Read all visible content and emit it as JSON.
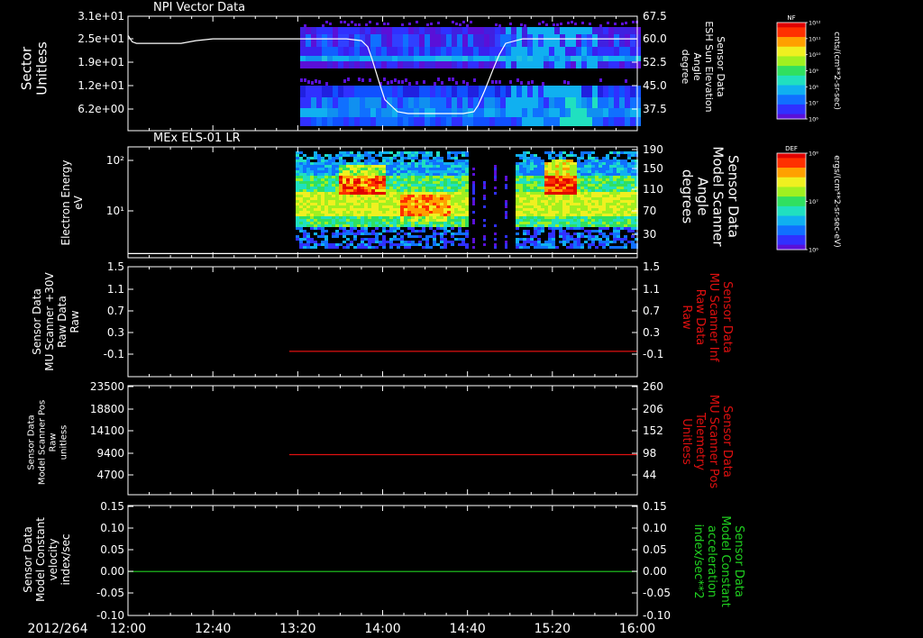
{
  "chart_data": [
    {
      "type": "heatmap",
      "title": "NPI Vector Data",
      "ylabel_left": [
        "Sector",
        "Unitless"
      ],
      "ylabel_right": [
        "Sensor Data",
        "ESH Sun Elevation",
        "Angle",
        "degree"
      ],
      "left_ticks": [
        "3.1e+01",
        "2.5e+01",
        "1.9e+01",
        "1.2e+01",
        "6.2e+00"
      ],
      "right_ticks": [
        "67.5",
        "60.0",
        "52.5",
        "45.0",
        "37.5"
      ],
      "ylim_left": [
        0,
        31
      ],
      "ylim_right": [
        30,
        67.5
      ],
      "overlay_series": {
        "name": "ESH Sun Elevation Angle",
        "color": "#ffffff",
        "x_minutes": [
          0,
          2,
          4,
          10,
          15,
          25,
          32,
          40,
          80,
          103,
          110,
          113,
          115,
          117,
          119,
          121,
          127,
          132,
          158,
          163,
          165,
          168,
          172,
          175,
          178,
          186,
          240
        ],
        "y": [
          61.2,
          59.1,
          58.6,
          58.6,
          58.6,
          58.6,
          59.5,
          60.1,
          60.1,
          60.1,
          59.5,
          57.5,
          53.5,
          49,
          44.5,
          40.2,
          36.2,
          35.6,
          35.6,
          36.2,
          38.3,
          43,
          50,
          55,
          58.6,
          60.1,
          60.1
        ]
      },
      "colorbar": {
        "label": "NF",
        "units": "cnts/(cm**2-sr-sec)",
        "ticks": [
          "10¹²",
          "10¹¹",
          "10¹⁰",
          "10⁹",
          "10⁸",
          "10⁷",
          "10⁶"
        ]
      }
    },
    {
      "type": "heatmap",
      "title": "MEx ELS-01 LR",
      "ylabel_left": [
        "Electron Energy",
        "eV"
      ],
      "ylabel_right": [
        "Sensor Data",
        "Model Scanner",
        "Angle",
        "degrees"
      ],
      "left_ticks": [
        "10²",
        "10¹"
      ],
      "right_ticks": [
        "190",
        "150",
        "110",
        "70",
        "30"
      ],
      "ylim_right": [
        5,
        190
      ],
      "overlay_series": {
        "name": "Model Scanner Angle",
        "color": "#ffffff",
        "x_minutes": [
          0,
          240
        ],
        "y": [
          12,
          12
        ]
      },
      "colorbar": {
        "label": "DEF",
        "units": "ergs/(cm**2-sr-sec-eV)",
        "ticks": [
          "10⁸",
          "10⁷",
          "10⁶"
        ]
      }
    },
    {
      "type": "line",
      "ylabel_left": [
        "Sensor Data",
        "MU Scanner +30V",
        "Raw Data",
        "Raw"
      ],
      "ylabel_right": [
        "Sensor Data",
        "MU Scanner Inf",
        "Raw Data",
        "Raw"
      ],
      "left_ticks": [
        "1.5",
        "1.1",
        "0.7",
        "0.3",
        "-0.1"
      ],
      "right_ticks": [
        "1.5",
        "1.1",
        "0.7",
        "0.3",
        "-0.1"
      ],
      "ylim_left": [
        -0.45,
        1.5
      ],
      "series": [
        {
          "name": "MU Scanner Inf Raw Data",
          "color": "#e01010",
          "x_minutes": [
            76,
            240
          ],
          "y": [
            0,
            0
          ]
        }
      ]
    },
    {
      "type": "line",
      "ylabel_left": [
        "Sensor Data",
        "Model Scanner Pos",
        "Raw",
        "unitless"
      ],
      "ylabel_right": [
        "Sensor Data",
        "MU Scanner Pos",
        "Telemetry",
        "Unitless"
      ],
      "left_ticks": [
        "23500",
        "18800",
        "14100",
        "9400",
        "4700"
      ],
      "right_ticks": [
        "260",
        "206",
        "152",
        "98",
        "44"
      ],
      "ylim_left": [
        0,
        23500
      ],
      "ylim_right": [
        -9,
        260
      ],
      "series": [
        {
          "name": "MU Scanner Pos Telemetry",
          "color": "#e01010",
          "x_minutes": [
            76,
            240
          ],
          "y": [
            90,
            90
          ]
        }
      ]
    },
    {
      "type": "line",
      "ylabel_left": [
        "Sensor Data",
        "Model Constant",
        "velocity",
        "index/sec"
      ],
      "ylabel_right": [
        "Sensor Data",
        "Model Constant",
        "acceleration",
        "index/sec**2"
      ],
      "left_ticks": [
        "0.15",
        "0.10",
        "0.05",
        "0.00",
        "-0.05",
        "-0.10"
      ],
      "right_ticks": [
        "0.15",
        "0.10",
        "0.05",
        "0.00",
        "-0.05",
        "-0.10"
      ],
      "ylim_left": [
        -0.1,
        0.15
      ],
      "series": [
        {
          "name": "Model Constant acceleration",
          "color": "#20d020",
          "x_minutes": [
            0,
            240
          ],
          "y": [
            0,
            0
          ]
        }
      ]
    }
  ],
  "x_axis": {
    "date_label": "2012/264",
    "tick_labels": [
      "12:00",
      "12:40",
      "13:20",
      "14:00",
      "14:40",
      "15:20",
      "16:00"
    ],
    "xlim_minutes": [
      0,
      240
    ]
  }
}
